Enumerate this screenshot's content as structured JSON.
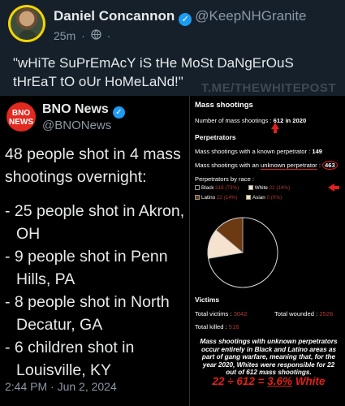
{
  "post": {
    "author_name": "Daniel Concannon",
    "verified_mark": "✓",
    "handle": "@KeepNHGranite",
    "age": "25m",
    "dot": "·",
    "globe_icon": "globe-icon",
    "text": "\"wHiTe SuPrEmAcY iS tHe MoSt DaNgErOuS tHrEaT tO oUr HoMeLaNd!\""
  },
  "watermark": "T.ME/THEWHITEPOST",
  "quote": {
    "logo_top": "BNO",
    "logo_bottom": "NEWS",
    "name": "BNO News",
    "handle": "@BNONews",
    "intro": "48 people shot in 4 mass shootings overnight:",
    "items": [
      "- 25 people shot in Akron, OH",
      "- 9 people shot in Penn Hills, PA",
      "- 8 people shot in North Decatur, GA",
      "- 6 children shot in Louisville, KY"
    ],
    "time": "2:44 PM · Jun 2, 2024"
  },
  "infographic": {
    "title": "Mass shootings",
    "total_prefix": "Number of mass shootings : ",
    "total_value": "612",
    "total_suffix": " in 2020",
    "perp_header": "Perpetrators",
    "known_label": "Mass shootings with a known perpetrator : ",
    "known_value": "149",
    "unknown_prefix": "Mass shootings with an ",
    "unknown_underlined": "unknown perpetrator",
    "unknown_colon": " : ",
    "unknown_value": "463",
    "by_race": "Perpetrators by race :",
    "race": {
      "black_label": "Black",
      "black_value": "318 (73%)",
      "white_label": "White",
      "white_value": "22 (14%)",
      "latino_label": "Latino",
      "latino_value": "22 (14%)",
      "asian_label": "Asian",
      "asian_value": "0 (0%)"
    },
    "colors": {
      "black": "#000000",
      "white": "#f5e3cf",
      "latino": "#6b3a12",
      "asian": "#f3e7b0",
      "accent": "#e0201a"
    },
    "victims_header": "Victims",
    "total_victims_label": "Total victims : ",
    "total_victims_value": "3042",
    "total_wounded_label": "Total wounded : ",
    "total_wounded_value": "2526",
    "total_killed_label": "Total killed : ",
    "total_killed_value": "516",
    "note": "Mass shootings with unknown perpetrators occur entirely in Black and Latino areas as part of gang warfare, meaning that, for the year 2020, Whites were responsible for 22 out of 612 mass shootings.",
    "formula_lead": "22 ÷ 612 = ",
    "formula_pct": "3.6%",
    "formula_tail": " White"
  },
  "chart_data": {
    "type": "pie",
    "categories": [
      "Black",
      "White",
      "Latino",
      "Asian"
    ],
    "values": [
      73,
      14,
      14,
      0
    ]
  }
}
